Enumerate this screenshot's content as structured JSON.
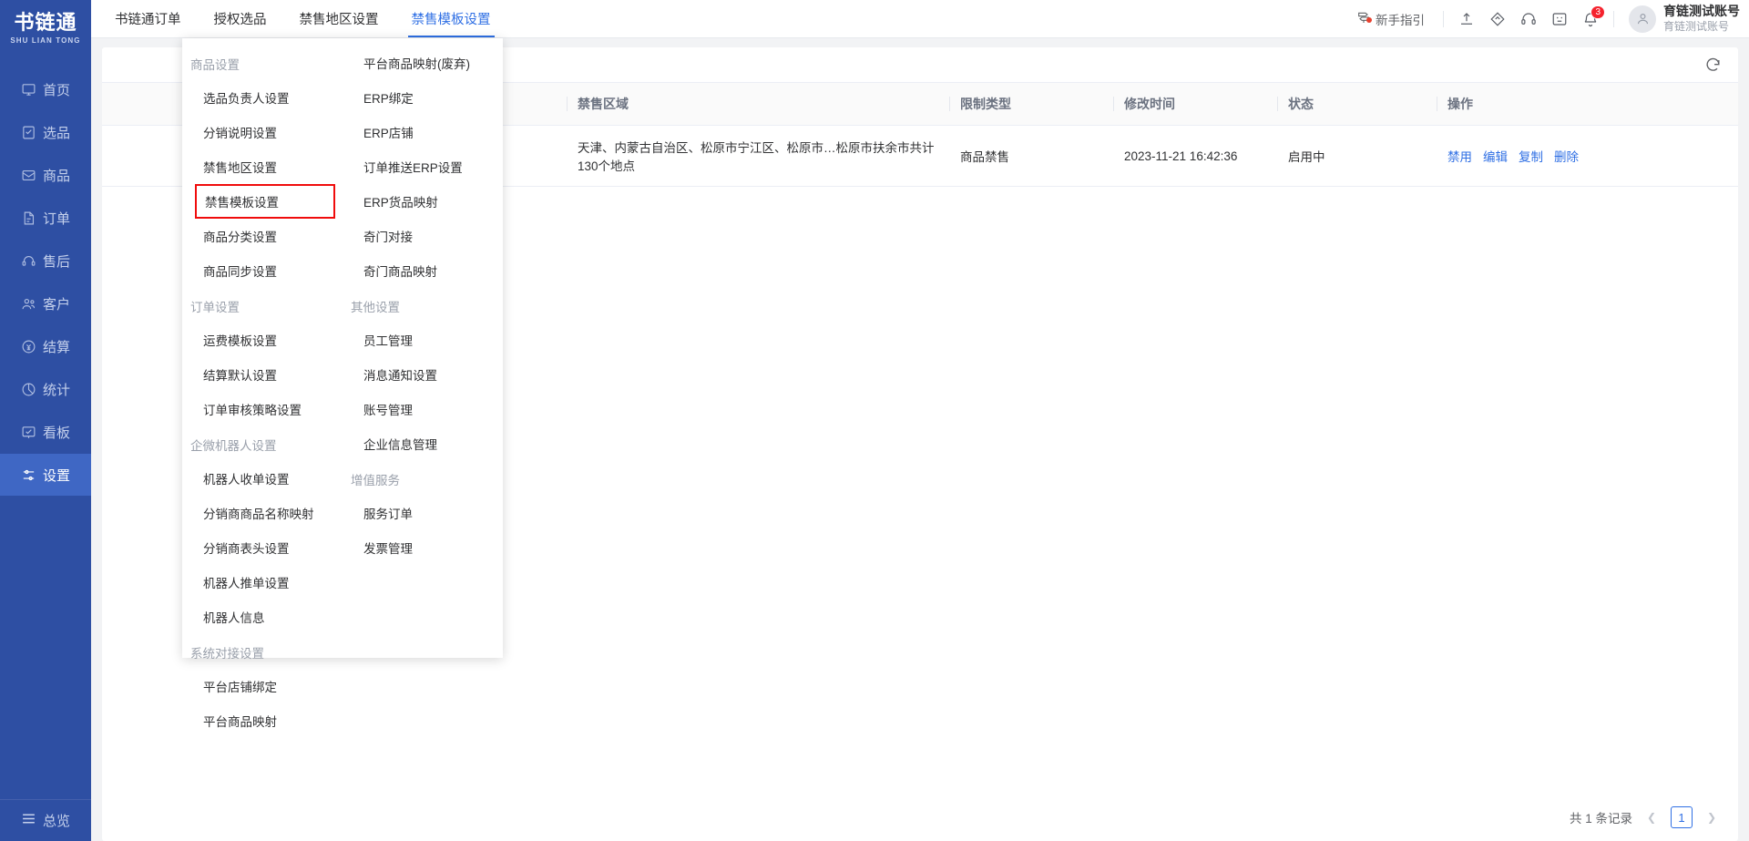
{
  "brand": {
    "name_cn": "书链通",
    "name_en": "SHU LIAN TONG"
  },
  "sidebar": {
    "items": [
      {
        "label": "首页",
        "icon": "monitor-icon",
        "active": false
      },
      {
        "label": "选品",
        "icon": "clipboard-check-icon",
        "active": false
      },
      {
        "label": "商品",
        "icon": "box-icon",
        "active": false
      },
      {
        "label": "订单",
        "icon": "file-list-icon",
        "active": false
      },
      {
        "label": "售后",
        "icon": "headset-icon",
        "active": false
      },
      {
        "label": "客户",
        "icon": "users-icon",
        "active": false
      },
      {
        "label": "结算",
        "icon": "money-circle-icon",
        "active": false
      },
      {
        "label": "统计",
        "icon": "pie-chart-icon",
        "active": false
      },
      {
        "label": "看板",
        "icon": "dashboard-icon",
        "active": false
      },
      {
        "label": "设置",
        "icon": "sliders-icon",
        "active": true
      }
    ],
    "bottom": {
      "label": "总览",
      "icon": "menu-icon"
    }
  },
  "topbar": {
    "tabs": [
      {
        "label": "书链通订单",
        "active": false
      },
      {
        "label": "授权选品",
        "active": false
      },
      {
        "label": "禁售地区设置",
        "active": false
      },
      {
        "label": "禁售模板设置",
        "active": true
      }
    ],
    "guide": {
      "label": "新手指引",
      "icon": "guidepost-icon"
    },
    "icons": [
      {
        "name": "upload-icon"
      },
      {
        "name": "tag-icon"
      },
      {
        "name": "headset-icon"
      },
      {
        "name": "feedback-icon"
      },
      {
        "name": "bell-icon",
        "badge": "3"
      }
    ],
    "user": {
      "name": "育链测试账号",
      "sub": "育链测试账号",
      "avatar_icon": "user-avatar-icon"
    }
  },
  "mega_menu": {
    "col1": [
      {
        "type": "group",
        "label": "商品设置"
      },
      {
        "type": "item",
        "label": "选品负责人设置"
      },
      {
        "type": "item",
        "label": "分销说明设置"
      },
      {
        "type": "item",
        "label": "禁售地区设置"
      },
      {
        "type": "item",
        "label": "禁售模板设置",
        "highlighted": true
      },
      {
        "type": "item",
        "label": "商品分类设置"
      },
      {
        "type": "item",
        "label": "商品同步设置"
      },
      {
        "type": "group",
        "label": "订单设置"
      },
      {
        "type": "item",
        "label": "运费模板设置"
      },
      {
        "type": "item",
        "label": "结算默认设置"
      },
      {
        "type": "item",
        "label": "订单审核策略设置"
      },
      {
        "type": "group",
        "label": "企微机器人设置"
      },
      {
        "type": "item",
        "label": "机器人收单设置"
      },
      {
        "type": "item",
        "label": "分销商商品名称映射"
      },
      {
        "type": "item",
        "label": "分销商表头设置"
      },
      {
        "type": "item",
        "label": "机器人推单设置"
      },
      {
        "type": "item",
        "label": "机器人信息"
      },
      {
        "type": "group",
        "label": "系统对接设置"
      },
      {
        "type": "item",
        "label": "平台店铺绑定"
      },
      {
        "type": "item",
        "label": "平台商品映射"
      }
    ],
    "col2": [
      {
        "type": "item",
        "label": "平台商品映射(废弃)"
      },
      {
        "type": "item",
        "label": "ERP绑定"
      },
      {
        "type": "item",
        "label": "ERP店铺"
      },
      {
        "type": "item",
        "label": "订单推送ERP设置"
      },
      {
        "type": "item",
        "label": "ERP货品映射"
      },
      {
        "type": "item",
        "label": "奇门对接"
      },
      {
        "type": "item",
        "label": "奇门商品映射"
      },
      {
        "type": "group",
        "label": "其他设置"
      },
      {
        "type": "item",
        "label": "员工管理"
      },
      {
        "type": "item",
        "label": "消息通知设置"
      },
      {
        "type": "item",
        "label": "账号管理"
      },
      {
        "type": "item",
        "label": "企业信息管理"
      },
      {
        "type": "group",
        "label": "增值服务"
      },
      {
        "type": "item",
        "label": "服务订单"
      },
      {
        "type": "item",
        "label": "发票管理"
      }
    ]
  },
  "table": {
    "refresh_icon": "refresh-icon",
    "columns": [
      "",
      "禁售区域",
      "限制类型",
      "修改时间",
      "状态",
      "操作"
    ],
    "rows": [
      {
        "name": "",
        "region": "天津、内蒙古自治区、松原市宁江区、松原市…松原市扶余市共计130个地点",
        "limit_type": "商品禁售",
        "modified_at": "2023-11-21 16:42:36",
        "status": "启用中",
        "actions": [
          "禁用",
          "编辑",
          "复制",
          "删除"
        ]
      }
    ]
  },
  "pagination": {
    "total_text": "共 1 条记录",
    "current_page": "1",
    "prev_icon": "chevron-left-icon",
    "next_icon": "chevron-right-icon"
  },
  "colors": {
    "primary": "#2f6fe4",
    "sidebar": "#2e4fa3",
    "sidebar_active": "#3f67c4",
    "highlight_border": "#f00c0c",
    "badge": "#f5222d"
  }
}
